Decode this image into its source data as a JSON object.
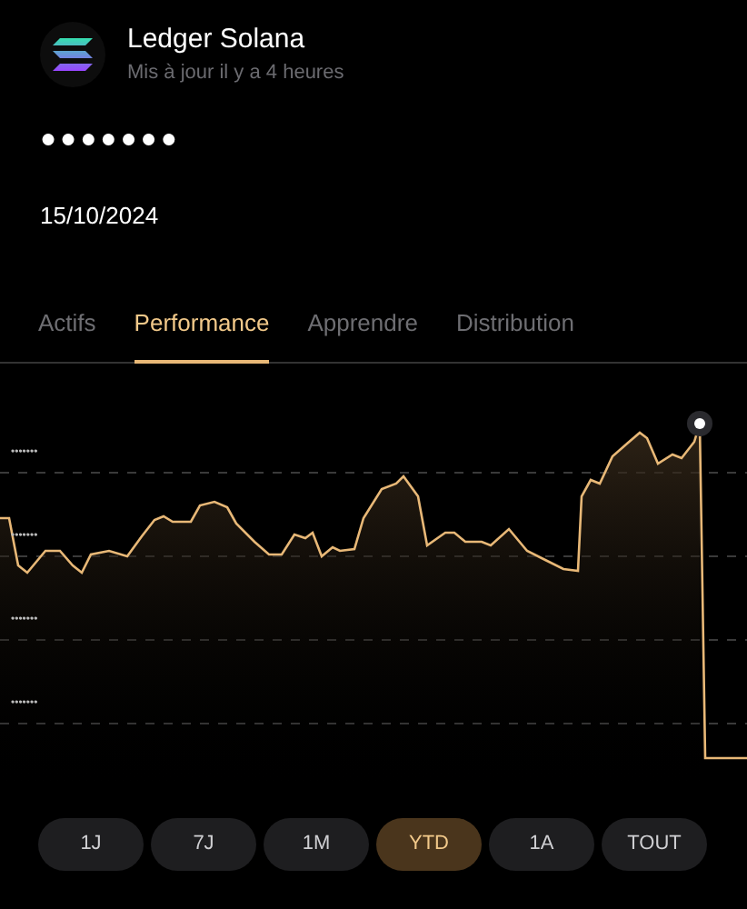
{
  "account": {
    "name": "Ledger Solana",
    "updated": "Mis à jour il y a 4 heures"
  },
  "balance": "●●●●●●●",
  "date": "15/10/2024",
  "tabs": [
    {
      "label": "Actifs",
      "selected": false
    },
    {
      "label": "Performance",
      "selected": true
    },
    {
      "label": "Apprendre",
      "selected": false
    },
    {
      "label": "Distribution",
      "selected": false
    }
  ],
  "chart": {
    "y_labels": [
      "•••••••",
      "•••••••",
      "•••••••",
      "•••••••"
    ]
  },
  "periods": [
    {
      "label": "1J",
      "selected": false
    },
    {
      "label": "7J",
      "selected": false
    },
    {
      "label": "1M",
      "selected": false
    },
    {
      "label": "YTD",
      "selected": true
    },
    {
      "label": "1A",
      "selected": false
    },
    {
      "label": "TOUT",
      "selected": false
    }
  ]
}
